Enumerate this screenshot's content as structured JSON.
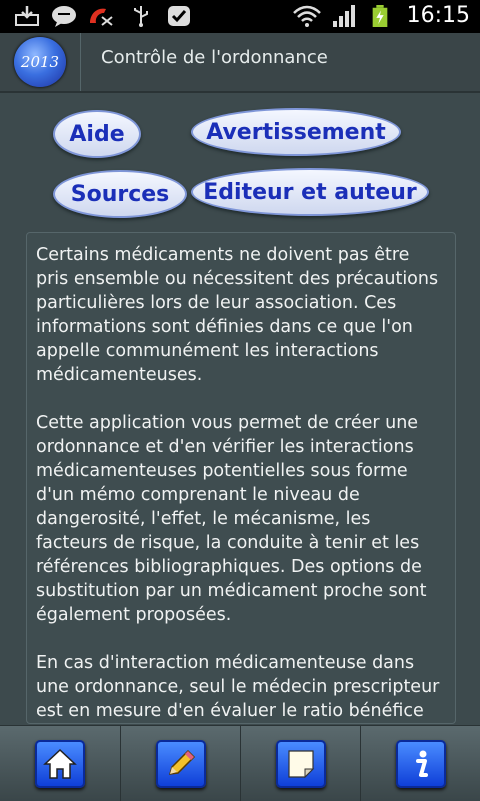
{
  "status_bar": {
    "time": "16:15",
    "icons": [
      "download-icon",
      "chat-icon",
      "missed-call-icon",
      "usb-icon",
      "task-icon",
      "wifi-icon",
      "signal-icon",
      "battery-charging-icon"
    ]
  },
  "header": {
    "logo_text": "2013",
    "title": "Contrôle de l'ordonnance"
  },
  "buttons": {
    "aide": "Aide",
    "avertissement": "Avertissement",
    "sources": "Sources",
    "editeur": "Editeur et auteur"
  },
  "content": {
    "paragraphs": [
      "Certains médicaments ne doivent pas être pris ensemble ou nécessitent des précautions particulières lors de leur association. Ces informations sont définies dans ce que l'on appelle communément les interactions médicamenteuses.",
      "Cette application vous permet de créer une ordonnance et d'en vérifier les interactions médicamenteuses potentielles sous forme d'un mémo comprenant le niveau de dangerosité, l'effet, le mécanisme, les facteurs de risque, la conduite à tenir et les références bibliographiques. Des options de substitution par un médicament proche sont également proposées.",
      "En cas d'interaction médicamenteuse dans une ordonnance, seul le médecin prescripteur est en mesure d'en évaluer le ratio bénéfice"
    ]
  },
  "toolbar": {
    "icons": [
      "home-icon",
      "pencil-icon",
      "note-icon",
      "info-icon"
    ]
  },
  "colors": {
    "background": "#3d4a4d",
    "button_text": "#1b2fb8",
    "toolbar_button": "#2060f0"
  }
}
